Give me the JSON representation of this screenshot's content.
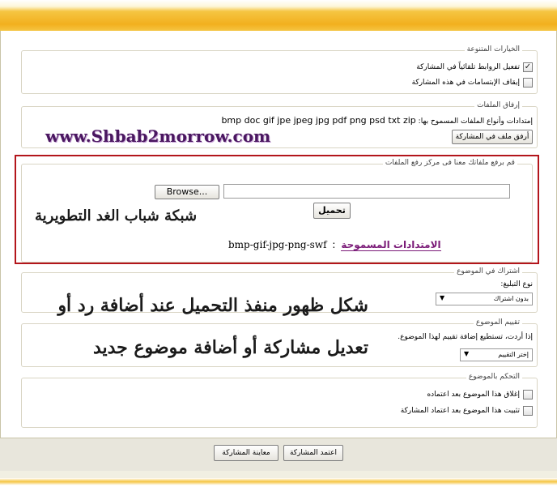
{
  "misc_options": {
    "legend": "الخيارات المتنوعة",
    "auto_links_label": "تفعيل الروابط تلقائياً في المشاركة",
    "auto_links_checked": true,
    "disable_smilies_label": "إيقاف الإبتسامات في هذه المشاركة",
    "disable_smilies_checked": false
  },
  "attachments": {
    "legend": "إرفاق الملفات",
    "allowed_label": "إمتدادات وأنواع الملفات المسموح بها:",
    "allowed_list": "bmp doc gif jpe jpeg jpg pdf png psd txt zip",
    "attach_button": "أرفق ملف في المشاركة"
  },
  "watermark_url": "www.Shbab2morrow.com",
  "upload_center": {
    "legend": "قم برفع ملفاتك معنا فى مركز رفع الملفات",
    "browse_button": "Browse...",
    "file_value": "",
    "upload_button": "تحميل",
    "allowed_title": "الامتدادات المسموحة",
    "allowed_sep": ":",
    "allowed_ext": "bmp-gif-jpg-png-swf",
    "watermark_network": "شبكة شباب الغد التطويرية"
  },
  "subscribe": {
    "legend": "اشتراك في الموضوع",
    "notify_label": "نوع التبليغ:",
    "notify_value": "بدون اشتراك"
  },
  "rate": {
    "legend": "تقييم الموضوع",
    "rate_label": "إذا أردت، تستطيع إضافة تقييم لهذا الموضوع.",
    "rate_value": "إختر التقييم"
  },
  "caption": {
    "line1": "شكل ظهور منفذ التحميل عند أضافة رد أو",
    "line2": "تعديل مشاركة أو أضافة موضوع جديد"
  },
  "thread_control": {
    "legend": "التحكم بالموضوع",
    "close_label": "إغلاق هذا الموضوع بعد اعتماده",
    "close_checked": false,
    "stick_label": "تثبيت هذا الموضوع بعد اعتماد المشاركة",
    "stick_checked": false
  },
  "actions": {
    "submit": "اعتمد المشاركة",
    "preview": "معاينة المشاركة"
  },
  "colors": {
    "accent": "#f2b01e",
    "upload_border": "#b3151b",
    "allowed_title": "#7b1b78",
    "watermark_url": "#4a1760"
  }
}
